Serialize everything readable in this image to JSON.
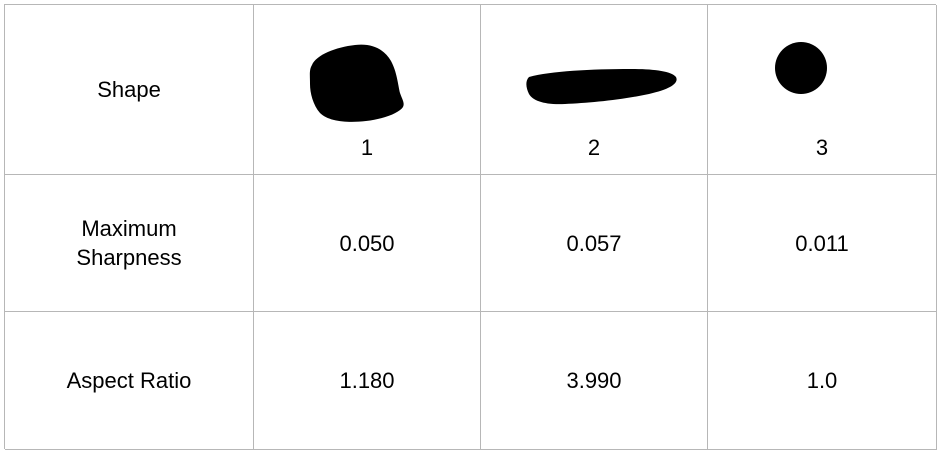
{
  "table": {
    "row_labels": {
      "shape": "Shape",
      "sharpness_line1": "Maximum",
      "sharpness_line2": "Sharpness",
      "aspect": "Aspect Ratio"
    },
    "shapes": [
      {
        "number": "1",
        "icon": "irregular-blob-icon",
        "sharpness": "0.050",
        "aspect_ratio": "1.180"
      },
      {
        "number": "2",
        "icon": "elongated-blob-icon",
        "sharpness": "0.057",
        "aspect_ratio": "3.990"
      },
      {
        "number": "3",
        "icon": "circle-icon",
        "sharpness": "0.011",
        "aspect_ratio": "1.0"
      }
    ],
    "colors": {
      "border": "#b7b7b7",
      "shape_fill": "#000000",
      "text": "#000000"
    }
  }
}
